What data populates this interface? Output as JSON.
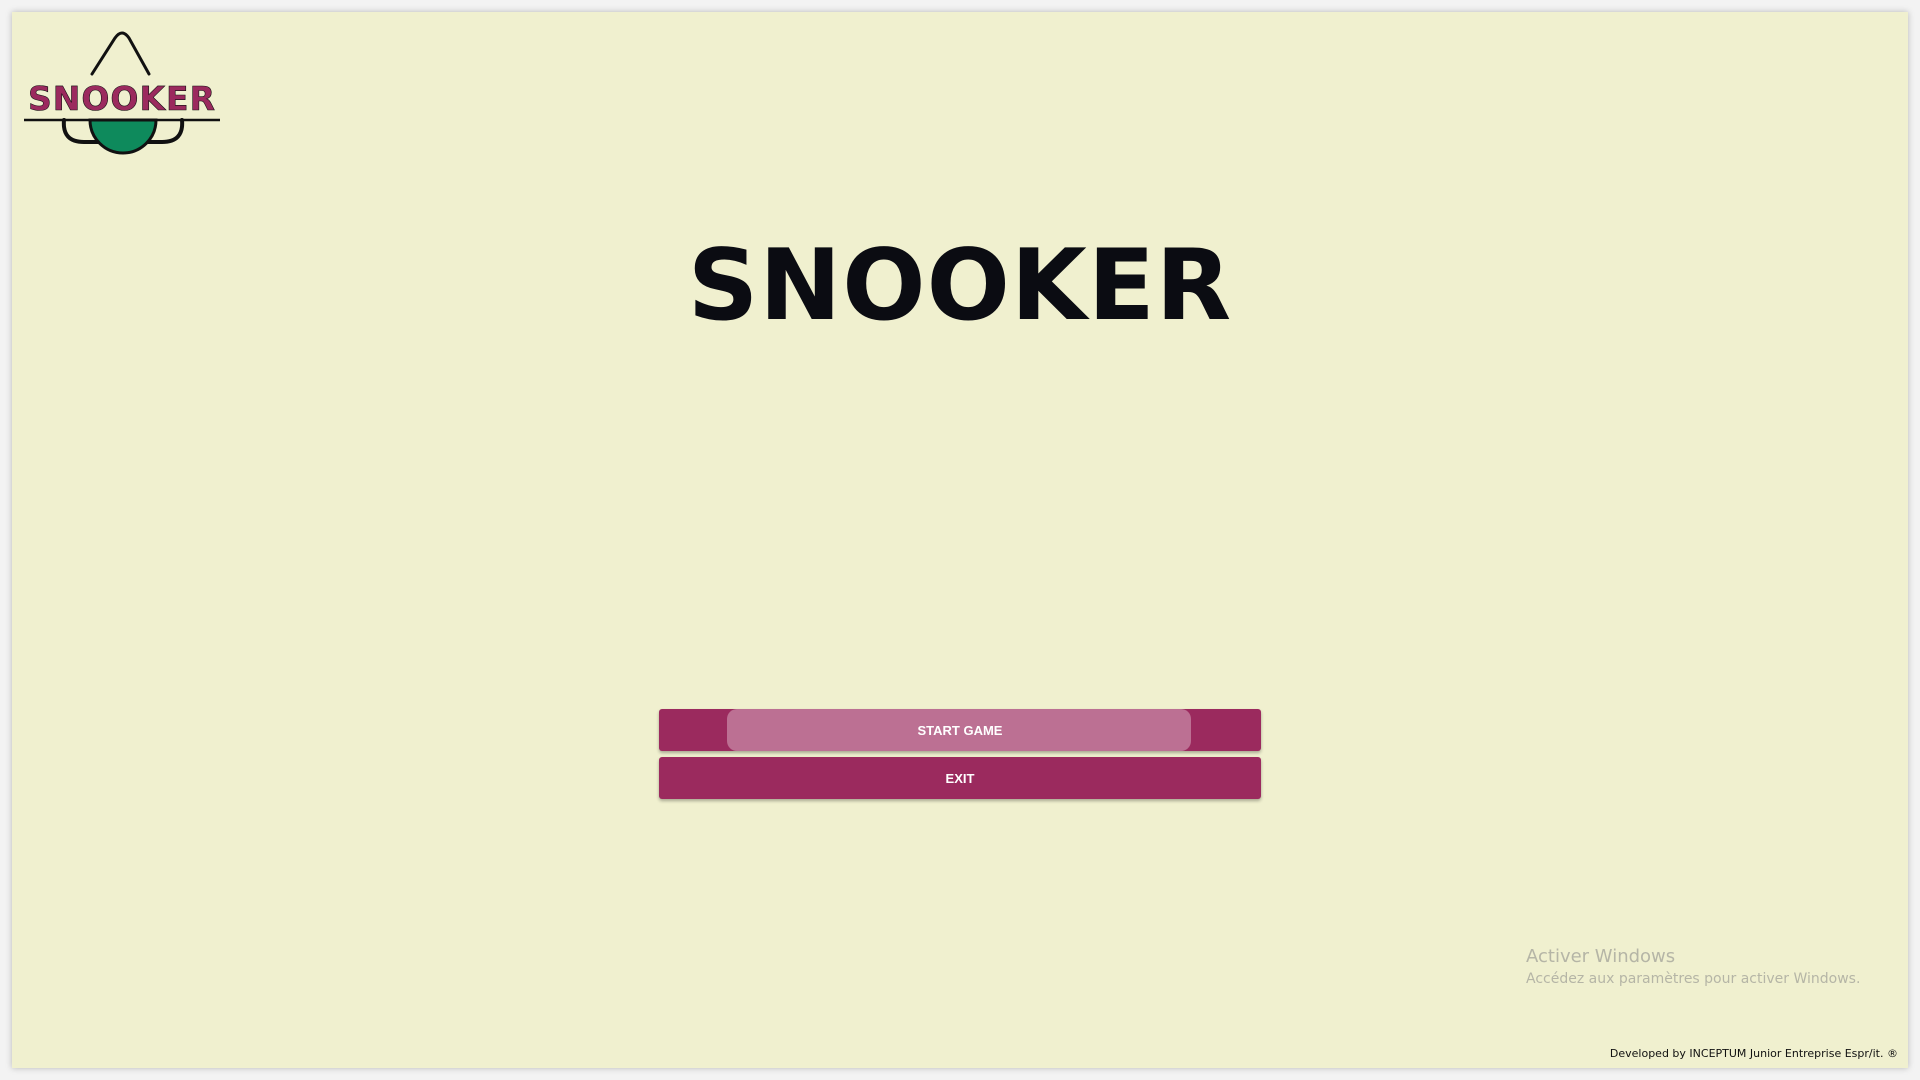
{
  "logo": {
    "text": "SNOOKER",
    "icon": "snooker-ball-logo",
    "text_color": "#9b2a5e",
    "ball_color": "#0e8a5c"
  },
  "title": "SNOOKER",
  "menu": {
    "start_label": "START GAME",
    "exit_label": "EXIT",
    "button_color": "#9b2a5e"
  },
  "watermark": {
    "title": "Activer Windows",
    "subtitle": "Accédez aux paramètres pour activer Windows."
  },
  "footer": {
    "credit": "Developed by INCEPTUM Junior Entreprise Espr/it. ®"
  },
  "colors": {
    "background": "#f0f0cf",
    "title": "#0b0c12"
  }
}
